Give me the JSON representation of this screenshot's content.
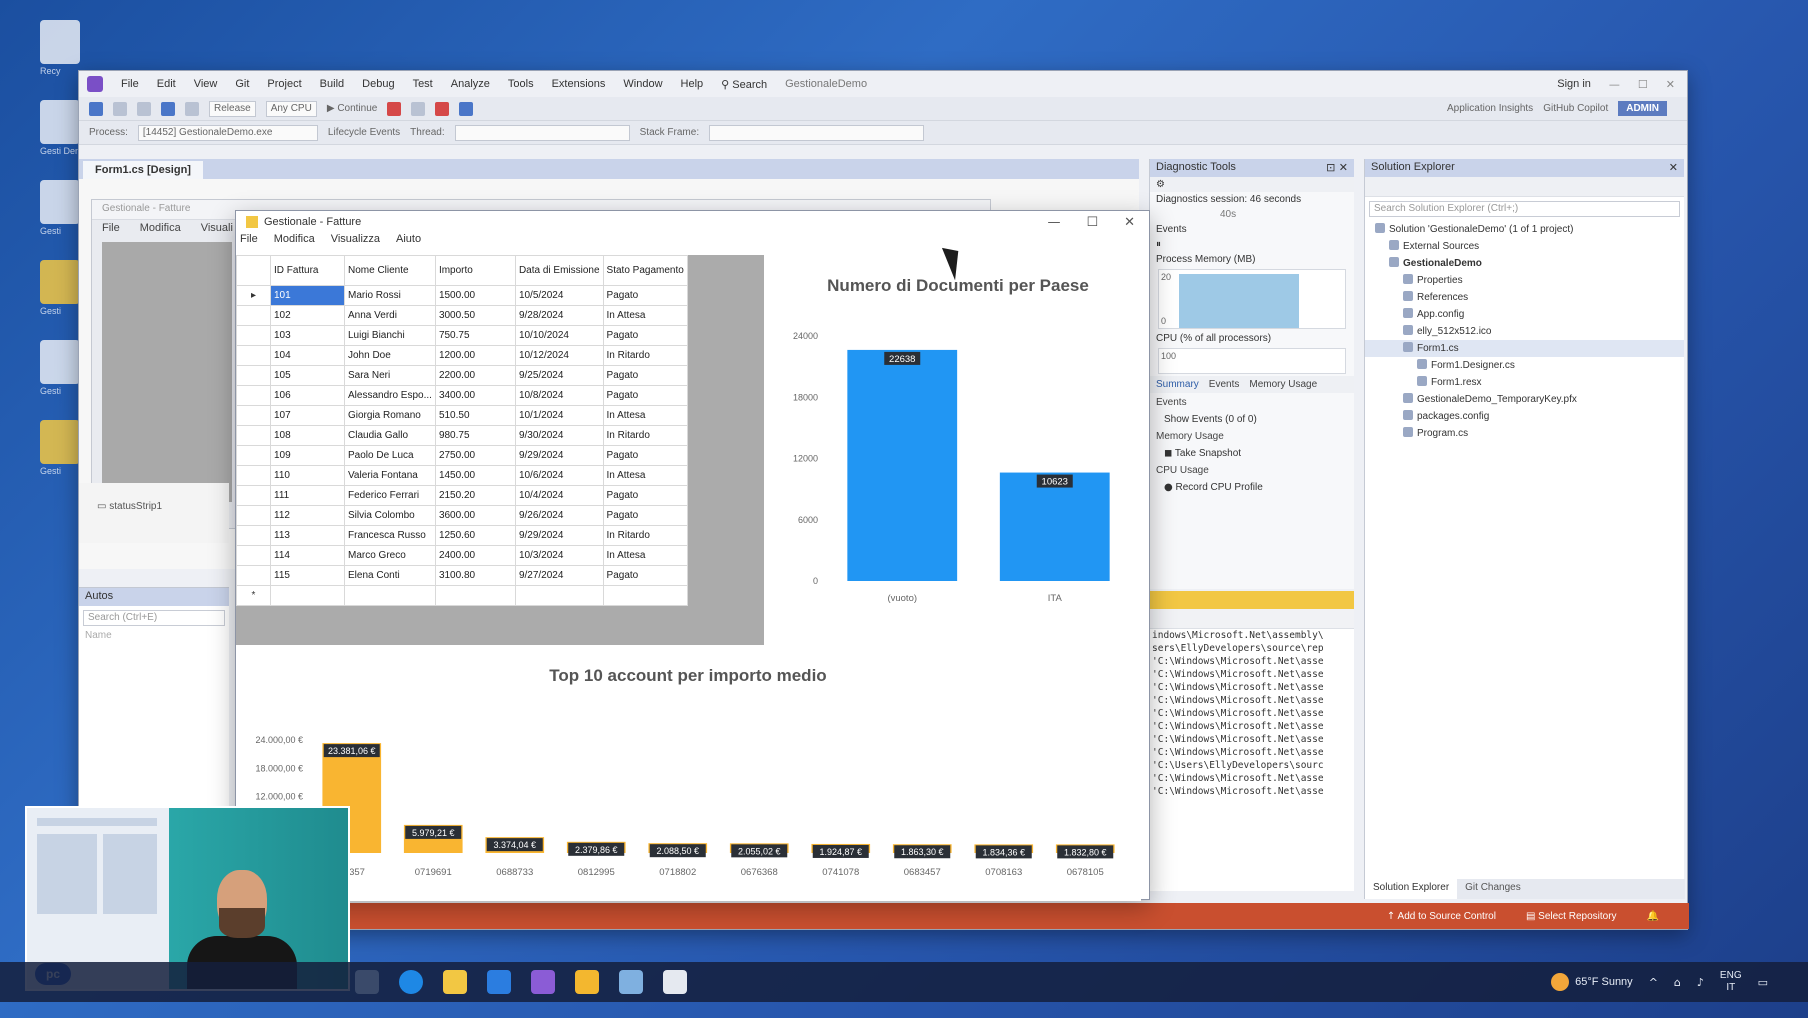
{
  "desktop": {
    "icons": [
      "Recy",
      "Gesti Den",
      "Gesti",
      "Gesti",
      "Gesti",
      "Gesti"
    ]
  },
  "vs": {
    "menu": [
      "File",
      "Edit",
      "View",
      "Git",
      "Project",
      "Build",
      "Debug",
      "Test",
      "Analyze",
      "Tools",
      "Extensions",
      "Window",
      "Help"
    ],
    "search_label": "Search",
    "title": "GestionaleDemo",
    "sign_in": "Sign in",
    "toolbar": {
      "config": "Release",
      "platform": "Any CPU",
      "continue": "Continue",
      "app_insights": "Application Insights",
      "copilot": "GitHub Copilot",
      "admin": "ADMIN"
    },
    "toolbar2": {
      "process_label": "Process:",
      "process_value": "[14452] GestionaleDemo.exe",
      "lifecycle": "Lifecycle Events",
      "thread_label": "Thread:",
      "stack_frame": "Stack Frame:"
    },
    "doc_tab": "Form1.cs [Design]",
    "bg_form_title": "Gestionale - Fatture",
    "bg_form_menu": [
      "File",
      "Modifica",
      "Visuali"
    ],
    "tray_item": "statusStrip1",
    "autos": {
      "title": "Autos",
      "search": "Search (Ctrl+E)",
      "col": "Name"
    },
    "diag": {
      "title": "Diagnostic Tools",
      "session": "Diagnostics session: 46 seconds",
      "timeline": "40s",
      "events": "Events",
      "process_memory": "Process Memory (MB)",
      "mem_hi": "20",
      "mem_lo": "0",
      "cpu": "CPU (% of all processors)",
      "cpu_hi": "100",
      "tabs": [
        "Summary",
        "Events",
        "Memory Usage"
      ],
      "section_events": "Events",
      "show_events": "Show Events (0 of 0)",
      "section_memory": "Memory Usage",
      "take_snapshot": "Take Snapshot",
      "section_cpu": "CPU Usage",
      "record_cpu": "Record CPU Profile"
    },
    "output_lines": [
      "indows\\Microsoft.Net\\assembly\\",
      "sers\\EllyDevelopers\\source\\rep",
      "'C:\\Windows\\Microsoft.Net\\asse",
      "'C:\\Windows\\Microsoft.Net\\asse",
      "'C:\\Windows\\Microsoft.Net\\asse",
      "'C:\\Windows\\Microsoft.Net\\asse",
      "'C:\\Windows\\Microsoft.Net\\asse",
      "'C:\\Windows\\Microsoft.Net\\asse",
      "'C:\\Windows\\Microsoft.Net\\asse",
      "'C:\\Windows\\Microsoft.Net\\asse",
      "'C:\\Users\\EllyDevelopers\\sourc",
      "'C:\\Windows\\Microsoft.Net\\asse",
      "'C:\\Windows\\Microsoft.Net\\asse"
    ],
    "solution": {
      "title": "Solution Explorer",
      "search": "Search Solution Explorer (Ctrl+;)",
      "items": [
        {
          "label": "Solution 'GestionaleDemo' (1 of 1 project)",
          "indent": 0
        },
        {
          "label": "External Sources",
          "indent": 1
        },
        {
          "label": "GestionaleDemo",
          "indent": 1,
          "bold": true
        },
        {
          "label": "Properties",
          "indent": 2
        },
        {
          "label": "References",
          "indent": 2
        },
        {
          "label": "App.config",
          "indent": 2
        },
        {
          "label": "elly_512x512.ico",
          "indent": 2
        },
        {
          "label": "Form1.cs",
          "indent": 2,
          "selected": true
        },
        {
          "label": "Form1.Designer.cs",
          "indent": 3
        },
        {
          "label": "Form1.resx",
          "indent": 3
        },
        {
          "label": "GestionaleDemo_TemporaryKey.pfx",
          "indent": 2
        },
        {
          "label": "packages.config",
          "indent": 2
        },
        {
          "label": "Program.cs",
          "indent": 2
        }
      ],
      "bottom_tabs": [
        "Solution Explorer",
        "Git Changes"
      ]
    },
    "status": {
      "source_control": "Add to Source Control",
      "repository": "Select Repository"
    }
  },
  "app": {
    "title": "Gestionale - Fatture",
    "menu": [
      "File",
      "Modifica",
      "Visualizza",
      "Aiuto"
    ],
    "grid": {
      "columns": [
        "ID Fattura",
        "Nome Cliente",
        "Importo",
        "Data di Emissione",
        "Stato Pagamento"
      ],
      "rows": [
        [
          "101",
          "Mario Rossi",
          "1500.00",
          "10/5/2024",
          "Pagato"
        ],
        [
          "102",
          "Anna Verdi",
          "3000.50",
          "9/28/2024",
          "In Attesa"
        ],
        [
          "103",
          "Luigi Bianchi",
          "750.75",
          "10/10/2024",
          "Pagato"
        ],
        [
          "104",
          "John Doe",
          "1200.00",
          "10/12/2024",
          "In Ritardo"
        ],
        [
          "105",
          "Sara Neri",
          "2200.00",
          "9/25/2024",
          "Pagato"
        ],
        [
          "106",
          "Alessandro Espo...",
          "3400.00",
          "10/8/2024",
          "Pagato"
        ],
        [
          "107",
          "Giorgia Romano",
          "510.50",
          "10/1/2024",
          "In Attesa"
        ],
        [
          "108",
          "Claudia Gallo",
          "980.75",
          "9/30/2024",
          "In Ritardo"
        ],
        [
          "109",
          "Paolo De Luca",
          "2750.00",
          "9/29/2024",
          "Pagato"
        ],
        [
          "110",
          "Valeria Fontana",
          "1450.00",
          "10/6/2024",
          "In Attesa"
        ],
        [
          "111",
          "Federico Ferrari",
          "2150.20",
          "10/4/2024",
          "Pagato"
        ],
        [
          "112",
          "Silvia Colombo",
          "3600.00",
          "9/26/2024",
          "Pagato"
        ],
        [
          "113",
          "Francesca Russo",
          "1250.60",
          "9/29/2024",
          "In Ritardo"
        ],
        [
          "114",
          "Marco Greco",
          "2400.00",
          "10/3/2024",
          "In Attesa"
        ],
        [
          "115",
          "Elena Conti",
          "3100.80",
          "9/27/2024",
          "Pagato"
        ]
      ]
    }
  },
  "chart_data": [
    {
      "type": "bar",
      "title": "Numero di Documenti per Paese",
      "categories": [
        "(vuoto)",
        "ITA"
      ],
      "values": [
        22638,
        10623
      ],
      "ylim": [
        0,
        24000
      ],
      "yticks": [
        "0",
        "6000",
        "12000",
        "18000",
        "24000"
      ],
      "color": "#2196f3",
      "grid": false
    },
    {
      "type": "bar",
      "title": "Top 10 account per importo medio",
      "categories": [
        "04357",
        "0719691",
        "0688733",
        "0812995",
        "0718802",
        "0676368",
        "0741078",
        "0683457",
        "0708163",
        "0678105"
      ],
      "values": [
        23381.06,
        5979.21,
        3374.04,
        2379.86,
        2088.5,
        2055.02,
        1924.87,
        1863.3,
        1834.36,
        1832.8
      ],
      "labels": [
        "23.381,06 €",
        "5.979,21 €",
        "3.374,04 €",
        "2.379,86 €",
        "2.088,50 €",
        "2.055,02 €",
        "1.924,87 €",
        "1.863,30 €",
        "1.834,36 €",
        "1.832,80 €"
      ],
      "ylim": [
        0,
        24000
      ],
      "yticks": [
        "24.000,00 €",
        "18.000,00 €",
        "12.000,00 €",
        "6.000,00 €"
      ],
      "color": "#f9b531",
      "grid": false
    }
  ],
  "taskbar": {
    "weather": "65°F Sunny",
    "lang": "ENG",
    "region": "IT"
  },
  "webcam": {
    "badge": "pc"
  }
}
